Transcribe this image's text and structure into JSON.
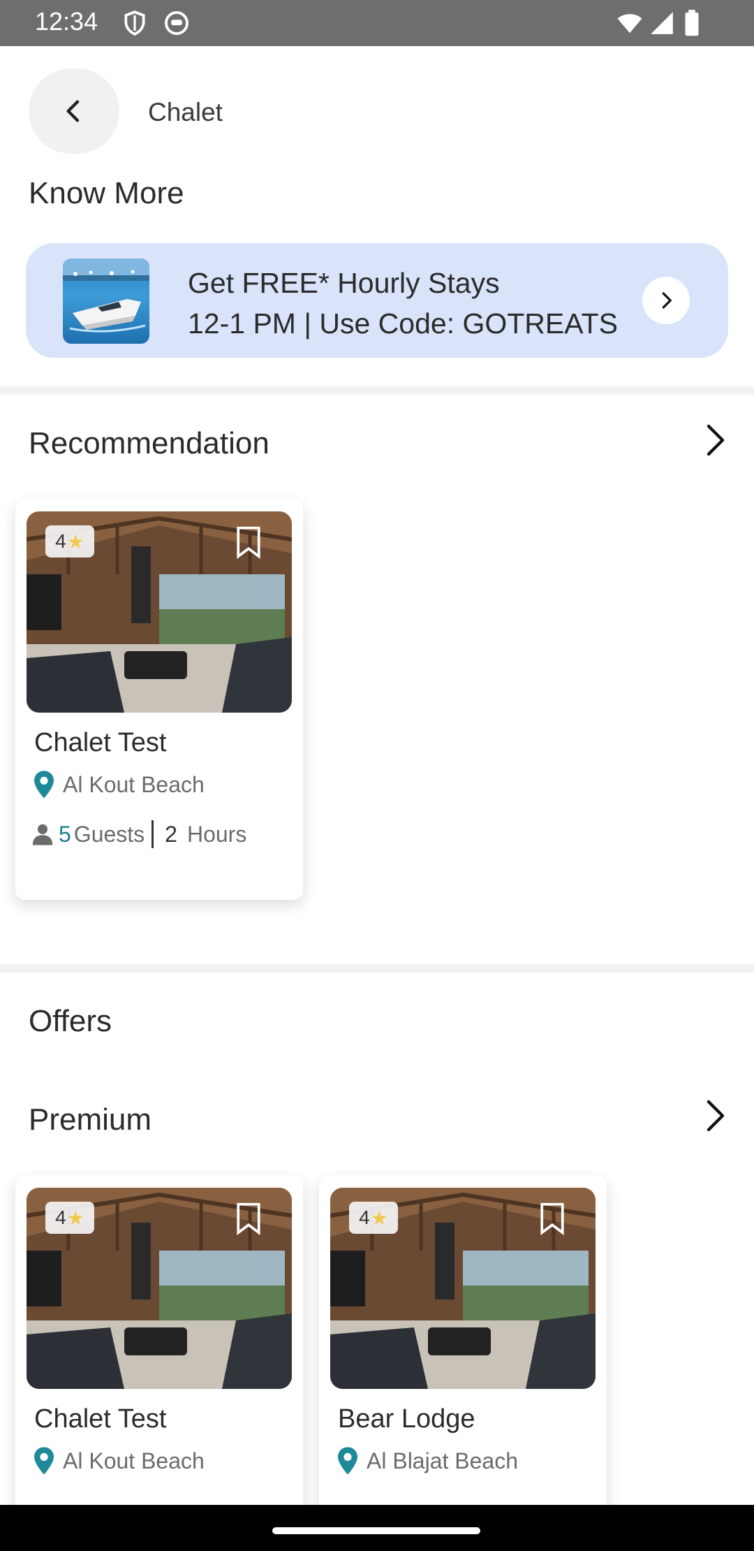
{
  "status_bar": {
    "time": "12:34",
    "left_icons": [
      "shield-icon",
      "face-icon"
    ],
    "right_icons": [
      "wifi-icon",
      "signal-icon",
      "battery-icon"
    ]
  },
  "header": {
    "back_icon": "chevron-left-icon",
    "title": "Chalet"
  },
  "know_more": {
    "title": "Know More",
    "banner": {
      "line1": "Get FREE* Hourly Stays",
      "line2": "12-1 PM | Use Code: GOTREATS",
      "arrow_icon": "chevron-right-icon",
      "background": "#d9e3fa"
    }
  },
  "recommendation": {
    "title": "Recommendation",
    "more_icon": "chevron-right-icon",
    "cards": [
      {
        "rating": "4",
        "name": "Chalet Test",
        "location": "Al Kout Beach",
        "guests": "5",
        "guests_label": "Guests",
        "hours": "2",
        "hours_label": "Hours"
      }
    ]
  },
  "offers": {
    "title": "Offers"
  },
  "premium": {
    "title": "Premium",
    "more_icon": "chevron-right-icon",
    "cards": [
      {
        "rating": "4",
        "name": "Chalet Test",
        "location": "Al Kout Beach"
      },
      {
        "rating": "4",
        "name": "Bear Lodge",
        "location": "Al Blajat Beach"
      }
    ]
  },
  "colors": {
    "accent_teal": "#1e7d8f",
    "star": "#f2c94c",
    "status_bar": "#6e6e6e"
  }
}
